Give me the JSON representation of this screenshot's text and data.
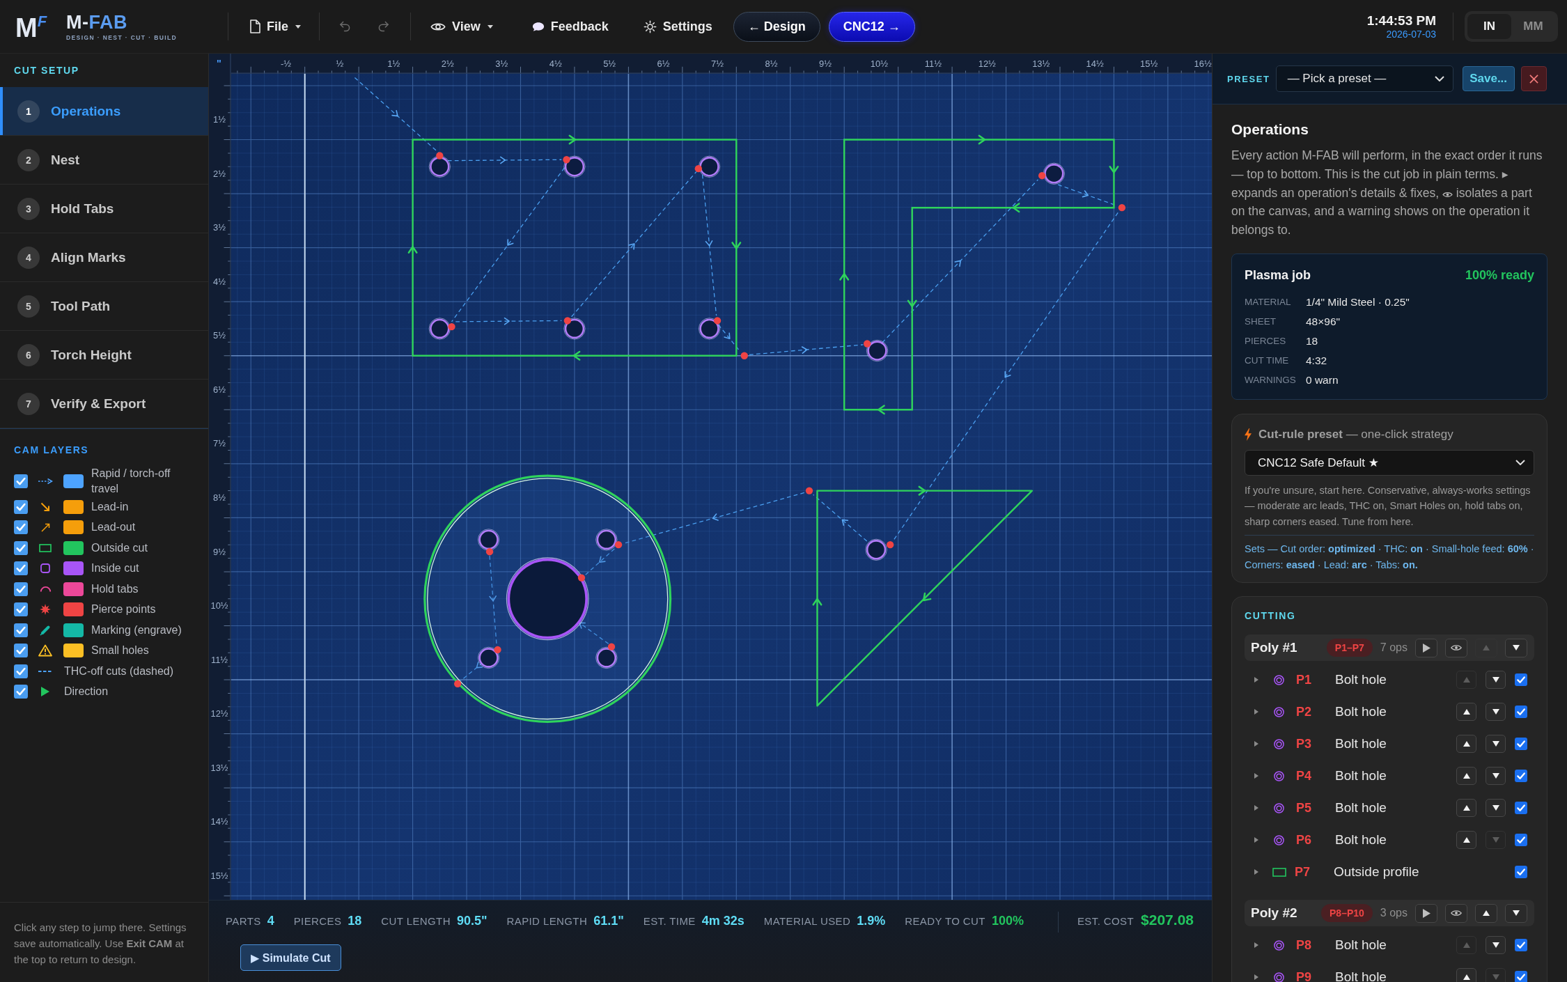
{
  "brand": {
    "mark": [
      "M",
      "F"
    ],
    "wordmark": [
      "M-",
      "FAB"
    ],
    "tagline": "DESIGN · NEST · CUT · BUILD"
  },
  "file_menu": {
    "label": "File",
    "dropdown": true
  },
  "history": [
    {
      "disabled": true
    },
    {
      "disabled": true
    }
  ],
  "menus": [
    {
      "label": "View",
      "dropdown": true
    },
    {
      "label": "Feedback",
      "dropdown": false
    },
    {
      "label": "Settings",
      "dropdown": false
    }
  ],
  "nav_buttons": [
    {
      "label": "← Design",
      "primary": false
    },
    {
      "label": "CNC12 →",
      "primary": true
    }
  ],
  "clock": {
    "time": "1:44:53 PM",
    "date": "2026-07-03"
  },
  "units": [
    {
      "label": "IN",
      "selected": true
    },
    {
      "label": "MM",
      "selected": false
    }
  ],
  "cut_setup": {
    "title": "CUT SETUP",
    "steps": [
      {
        "number": "1",
        "label": "Operations",
        "selected": true
      },
      {
        "number": "2",
        "label": "Nest",
        "selected": false
      },
      {
        "number": "3",
        "label": "Hold Tabs",
        "selected": false
      },
      {
        "number": "4",
        "label": "Align Marks",
        "selected": false
      },
      {
        "number": "5",
        "label": "Tool Path",
        "selected": false
      },
      {
        "number": "6",
        "label": "Torch Height",
        "selected": false
      },
      {
        "number": "7",
        "label": "Verify & Export",
        "selected": false
      }
    ]
  },
  "cam_layers": {
    "title": "CAM LAYERS",
    "items": [
      {
        "label": "Rapid / torch-off travel",
        "checked": true,
        "color": "#4da3ff"
      },
      {
        "label": "Lead-in",
        "checked": true,
        "color": "#f59e0b"
      },
      {
        "label": "Lead-out",
        "checked": true,
        "color": "#f59e0b"
      },
      {
        "label": "Outside cut",
        "checked": true,
        "color": "#22c55e"
      },
      {
        "label": "Inside cut",
        "checked": true,
        "color": "#a855f7"
      },
      {
        "label": "Hold tabs",
        "checked": true,
        "color": "#ec4899"
      },
      {
        "label": "Pierce points",
        "checked": true,
        "color": "#ef4444"
      },
      {
        "label": "Marking (engrave)",
        "checked": true,
        "color": "#14b8a6"
      },
      {
        "label": "Small holes",
        "checked": true,
        "color": "#fbbf24"
      },
      {
        "label": "THC-off cuts (dashed)",
        "checked": true
      },
      {
        "label": "Direction",
        "checked": true
      }
    ]
  },
  "help_text": "Click any step to jump there. Settings save automatically. Use **Exit CAM** at the top to return to design.",
  "canvas": {
    "ruler_unit": "\"",
    "ruler_top": [
      "-½",
      "½",
      "1½",
      "2½",
      "3½",
      "4½",
      "5½",
      "6½",
      "7½",
      "8½",
      "9½",
      "10½",
      "11½",
      "12½",
      "13½",
      "14½",
      "15½",
      "16½"
    ],
    "ruler_left": [
      "1½",
      "2½",
      "3½",
      "4½",
      "5½",
      "6½",
      "7½",
      "8½",
      "9½",
      "10½",
      "11½",
      "12½",
      "13½",
      "14½",
      "15½"
    ]
  },
  "stats": [
    {
      "label": "PARTS",
      "value": "4",
      "color": "#5fdcf5"
    },
    {
      "label": "PIERCES",
      "value": "18",
      "color": "#5fdcf5"
    },
    {
      "label": "CUT LENGTH",
      "value": "90.5\"",
      "color": "#5fdcf5"
    },
    {
      "label": "RAPID LENGTH",
      "value": "61.1\"",
      "color": "#5fdcf5"
    },
    {
      "label": "EST. TIME",
      "value": "4m 32s",
      "color": "#5fdcf5"
    },
    {
      "label": "MATERIAL USED",
      "value": "1.9%",
      "color": "#5fdcf5"
    },
    {
      "label": "READY TO CUT",
      "value": "100%",
      "color": "#22c55e"
    }
  ],
  "cost": {
    "label": "EST. COST",
    "value": "$207.08"
  },
  "simulate_button": "▶ Simulate Cut",
  "preset": {
    "label": "PRESET",
    "value": "— Pick a preset —",
    "save_label": "Save..."
  },
  "operations": {
    "title": "Operations",
    "description": [
      "Every action M-FAB will perform, in the exact order it runs — top to bottom. This is the cut job in plain terms. ▸ expands an operation's details & fixes,",
      "isolates a part on the canvas, and a warning shows on the operation it belongs to."
    ],
    "job": {
      "title": "Plasma job",
      "status": "100% ready",
      "fields": [
        {
          "label": "MATERIAL",
          "value": "1/4\" Mild Steel · 0.25\""
        },
        {
          "label": "SHEET",
          "value": "48×96\""
        },
        {
          "label": "PIERCES",
          "value": "18"
        },
        {
          "label": "CUT TIME",
          "value": "4:32"
        },
        {
          "label": "WARNINGS",
          "value": "0 warn"
        }
      ]
    },
    "cut_rule": {
      "heading": "**Cut-rule preset** — one-click strategy",
      "value": "CNC12 Safe Default ★",
      "description": "If you're unsure, start here. Conservative, always-works settings — moderate arc leads, THC on, Smart Holes on, hold tabs on, sharp corners eased. Tune from here.",
      "sets": "Sets — Cut order: **optimized** · THC: **on** · Small-hole feed: **60%** · Corners: **eased** · Lead: **arc** · Tabs: **on.**"
    },
    "cutting": {
      "title": "CUTTING",
      "groups": [
        {
          "name": "Poly #1",
          "range": "P1–P7",
          "count": "7 ops",
          "up_disabled": true,
          "down_disabled": false,
          "ops": [
            {
              "id": "P1",
              "label": "Bolt hole",
              "kind": "hole",
              "up_disabled": true,
              "down_disabled": false,
              "checked": true
            },
            {
              "id": "P2",
              "label": "Bolt hole",
              "kind": "hole",
              "up_disabled": false,
              "down_disabled": false,
              "checked": true
            },
            {
              "id": "P3",
              "label": "Bolt hole",
              "kind": "hole",
              "up_disabled": false,
              "down_disabled": false,
              "checked": true
            },
            {
              "id": "P4",
              "label": "Bolt hole",
              "kind": "hole",
              "up_disabled": false,
              "down_disabled": false,
              "checked": true
            },
            {
              "id": "P5",
              "label": "Bolt hole",
              "kind": "hole",
              "up_disabled": false,
              "down_disabled": false,
              "checked": true
            },
            {
              "id": "P6",
              "label": "Bolt hole",
              "kind": "hole",
              "up_disabled": false,
              "down_disabled": true,
              "checked": true
            },
            {
              "id": "P7",
              "label": "Outside profile",
              "kind": "profile",
              "checked": true
            }
          ]
        },
        {
          "name": "Poly #2",
          "range": "P8–P10",
          "count": "3 ops",
          "up_disabled": false,
          "down_disabled": false,
          "ops": [
            {
              "id": "P8",
              "label": "Bolt hole",
              "kind": "hole",
              "up_disabled": true,
              "down_disabled": false,
              "checked": true
            },
            {
              "id": "P9",
              "label": "Bolt hole",
              "kind": "hole",
              "up_disabled": false,
              "down_disabled": true,
              "checked": true
            }
          ]
        }
      ]
    }
  }
}
